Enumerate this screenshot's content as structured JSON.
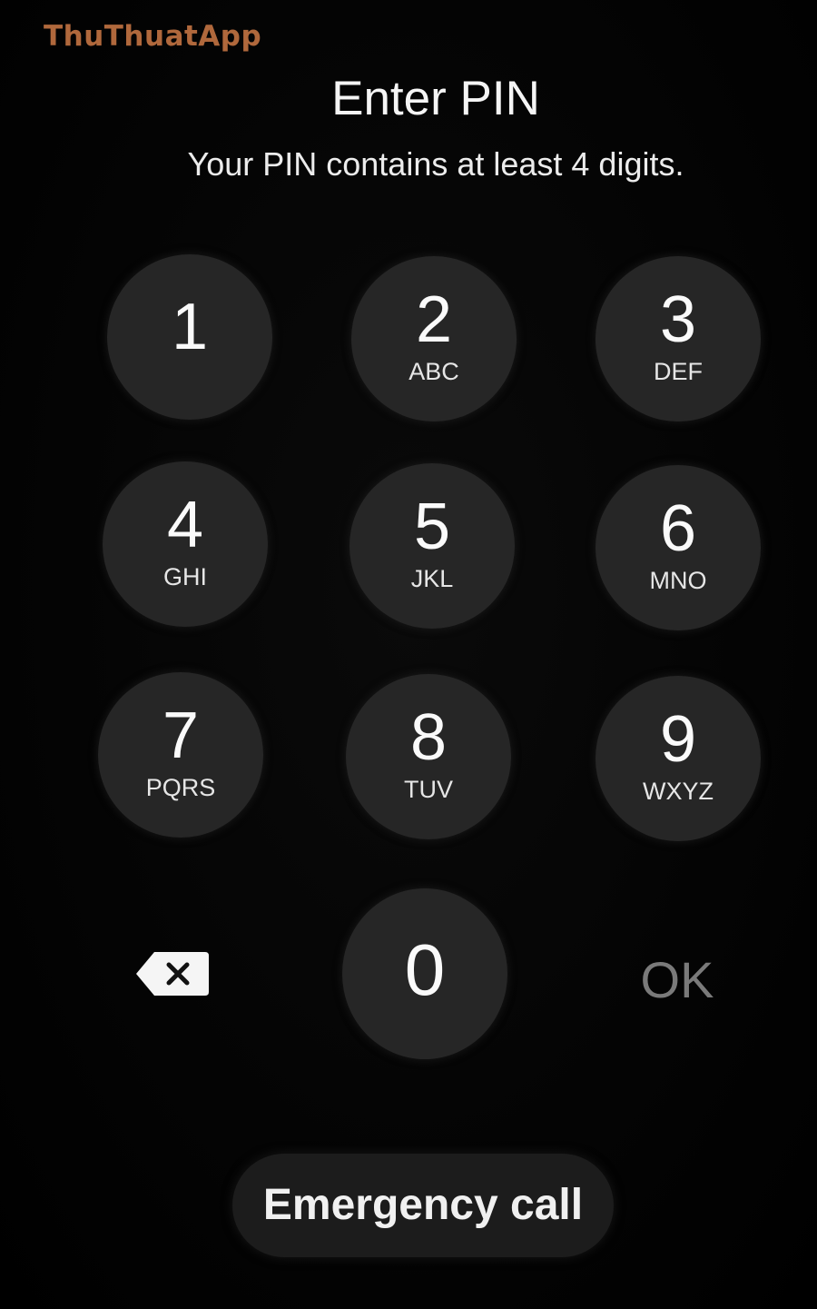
{
  "watermark": "ThuThuatApp",
  "header": {
    "title": "Enter PIN",
    "subtitle": "Your PIN contains at least 4 digits."
  },
  "keypad": {
    "keys": [
      {
        "digit": "1",
        "letters": ""
      },
      {
        "digit": "2",
        "letters": "ABC"
      },
      {
        "digit": "3",
        "letters": "DEF"
      },
      {
        "digit": "4",
        "letters": "GHI"
      },
      {
        "digit": "5",
        "letters": "JKL"
      },
      {
        "digit": "6",
        "letters": "MNO"
      },
      {
        "digit": "7",
        "letters": "PQRS"
      },
      {
        "digit": "8",
        "letters": "TUV"
      },
      {
        "digit": "9",
        "letters": "WXYZ"
      },
      {
        "digit": "0",
        "letters": ""
      }
    ],
    "backspace_icon": "backspace-icon",
    "ok_label": "OK"
  },
  "emergency_label": "Emergency call",
  "colors": {
    "background": "#000000",
    "key": "#262626",
    "ok_disabled": "#7a7a7a",
    "watermark": "#b0683c"
  }
}
